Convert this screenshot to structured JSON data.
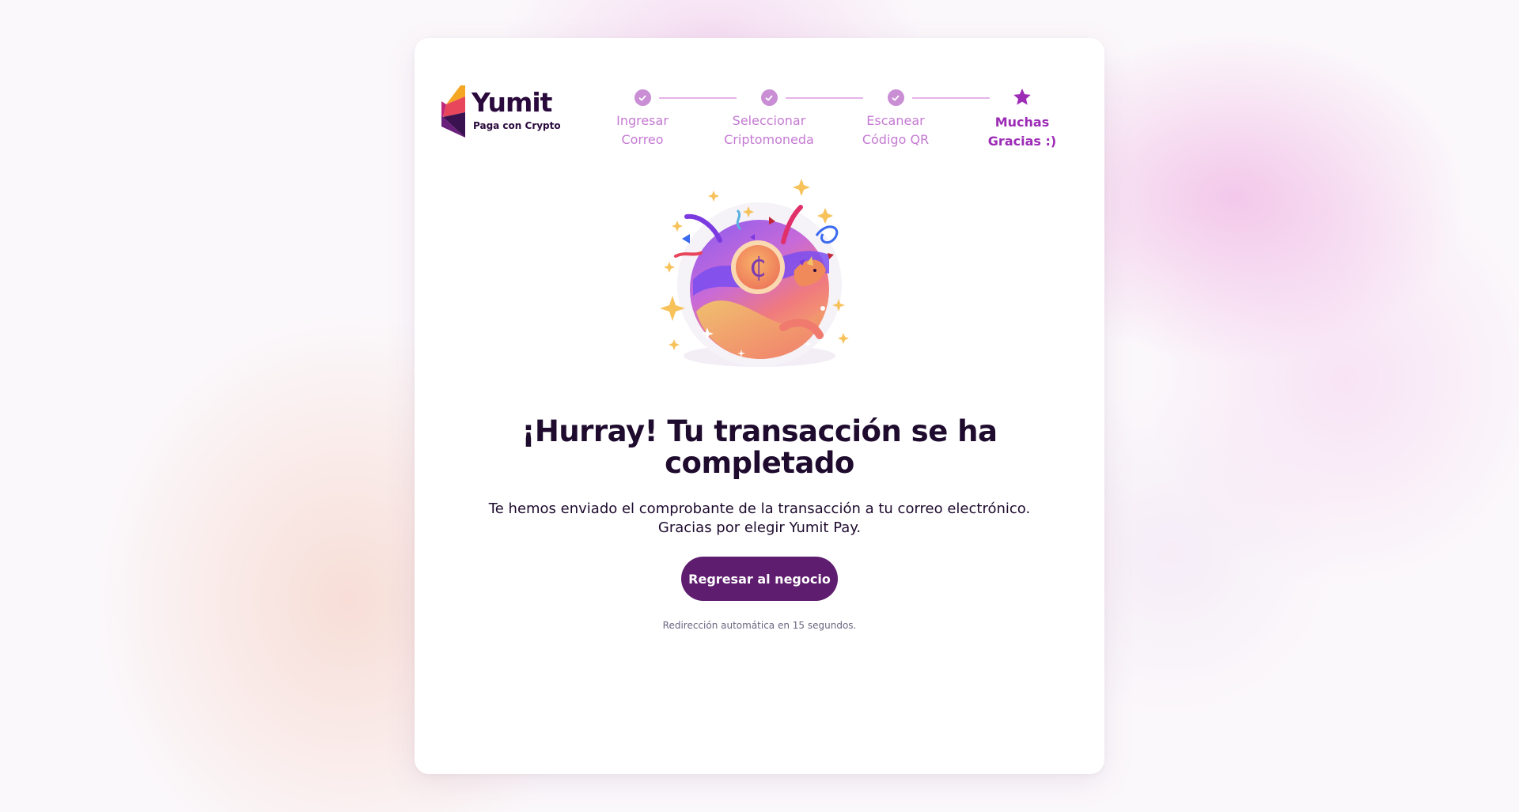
{
  "brand": {
    "name": "Yumit",
    "tagline": "Paga con Crypto"
  },
  "stepper": {
    "steps": [
      {
        "label": "Ingresar\nCorreo",
        "status": "completed",
        "icon": "check-icon"
      },
      {
        "label": "Seleccionar\nCriptomoneda",
        "status": "completed",
        "icon": "check-icon"
      },
      {
        "label": "Escanear\nCódigo QR",
        "status": "completed",
        "icon": "check-icon"
      },
      {
        "label": "Muchas\nGracias :)",
        "status": "current",
        "icon": "star-icon"
      }
    ]
  },
  "success": {
    "illustration": "celebration-coin-fox-illustration",
    "title": "¡Hurray! Tu transacción se ha\ncompletado",
    "message": "Te hemos enviado el comprobante de la transacción a tu correo electrónico.\nGracias por elegir Yumit Pay.",
    "button_label": "Regresar al negocio",
    "redirect_text": "Redirección automática en 15 segundos."
  },
  "colors": {
    "brand_dark": "#5e1d6e",
    "step_completed": "#c98ed4",
    "step_current": "#9c2bb6",
    "text_dark": "#1e0b2e"
  }
}
